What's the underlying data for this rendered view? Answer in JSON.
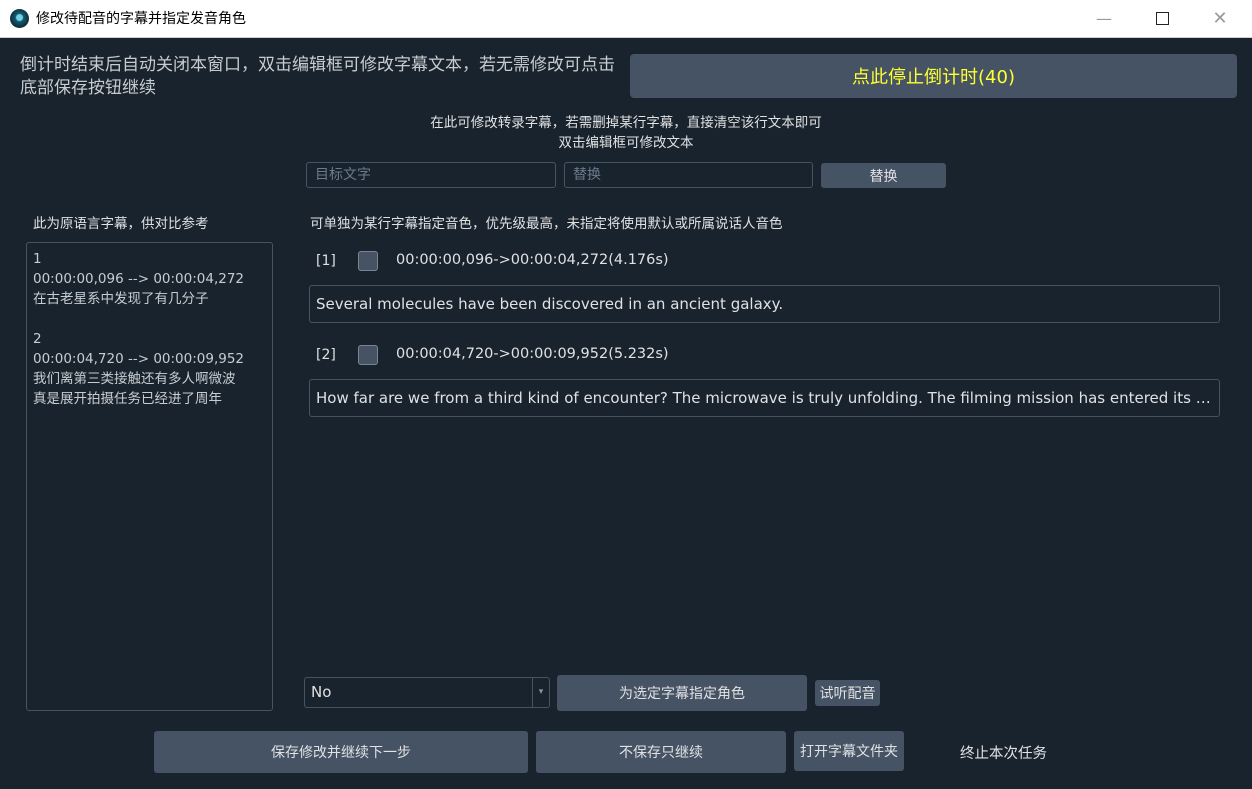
{
  "window": {
    "title": "修改待配音的字幕并指定发音角色",
    "min_glyph": "—",
    "close_glyph": "✕"
  },
  "header": {
    "notice": "倒计时结束后自动关闭本窗口，双击编辑框可修改字幕文本，若无需修改可点击底部保存按钮继续",
    "stop_countdown": "点此停止倒计时(40)"
  },
  "hint": {
    "line1": "在此可修改转录字幕，若需删掉某行字幕，直接清空该行文本即可",
    "line2": "双击编辑框可修改文本"
  },
  "replace": {
    "target_placeholder": "目标文字",
    "replace_placeholder": "替换",
    "button": "替换"
  },
  "original": {
    "label": "此为原语言字幕，供对比参考",
    "text": "1\n00:00:00,096 --> 00:00:04,272\n在古老星系中发现了有几分子\n\n2\n00:00:04,720 --> 00:00:09,952\n我们离第三类接触还有多人啊微波\n真是展开拍摄任务已经进了周年"
  },
  "voice_hint": "可单独为某行字幕指定音色，优先级最高，未指定将使用默认或所属说话人音色",
  "subtitles": [
    {
      "index": "[1]",
      "time": "00:00:00,096->00:00:04,272(4.176s)",
      "text": "Several molecules have been discovered in an ancient galaxy.",
      "checked": false
    },
    {
      "index": "[2]",
      "time": "00:00:04,720->00:00:09,952(5.232s)",
      "text": "How far are we from a third kind of encounter? The microwave is truly unfolding. The filming mission has entered its anniversary.",
      "checked": false
    }
  ],
  "role": {
    "selected": "No",
    "arrow_glyph": "▾",
    "assign_button": "为选定字幕指定角色",
    "listen_button": "试听配音"
  },
  "footer": {
    "save_continue": "保存修改并继续下一步",
    "no_save_continue": "不保存只继续",
    "open_folder": "打开字幕文件夹",
    "terminate": "终止本次任务"
  },
  "colors": {
    "background": "#19232d",
    "button": "#455364",
    "countdown_text": "#ffff33"
  },
  "icons": {
    "app": "app-logo-icon",
    "minimize": "minimize-icon",
    "maximize": "maximize-icon",
    "close": "close-icon",
    "dropdown": "chevron-down-icon"
  }
}
